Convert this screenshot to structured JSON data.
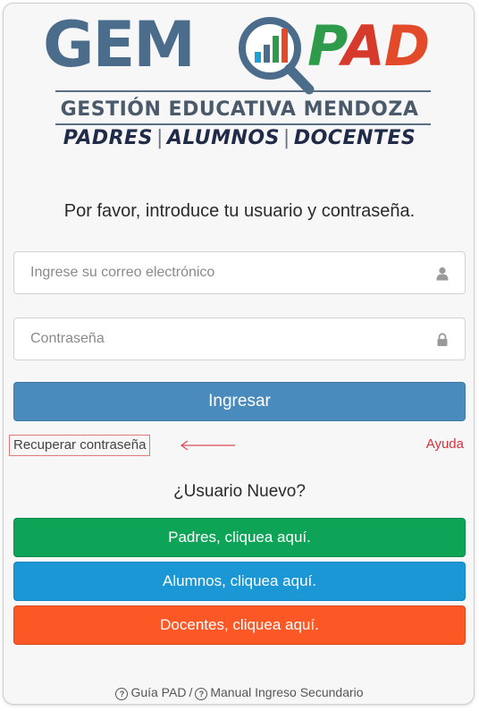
{
  "logo": {
    "gem": "GEM",
    "pad_p": "P",
    "pad_a": "A",
    "pad_d": "D",
    "subtitle": "GESTIÓN EDUCATIVA MENDOZA",
    "roles": [
      "PADRES",
      "ALUMNOS",
      "DOCENTES"
    ],
    "colors": {
      "gem": "#4b6c8a",
      "pad_p": "#2e9b4a",
      "pad_a": "#d63a2b",
      "pad_d": "#e24a2a"
    }
  },
  "login": {
    "prompt": "Por favor, introduce tu usuario y contraseña.",
    "email_placeholder": "Ingrese su correo electrónico",
    "email_value": "",
    "email_icon": "user-icon",
    "password_placeholder": "Contraseña",
    "password_value": "",
    "password_icon": "lock-icon",
    "submit_label": "Ingresar",
    "recover_label": "Recuperar contraseña",
    "help_label": "Ayuda"
  },
  "signup": {
    "heading": "¿Usuario Nuevo?",
    "padres_label": "Padres, cliquea aquí.",
    "alumnos_label": "Alumnos, cliquea aquí.",
    "docentes_label": "Docentes, cliquea aquí."
  },
  "footer": {
    "guide_label": "Guía PAD",
    "separator": "/",
    "manual_label": "Manual Ingreso Secundario"
  },
  "colors": {
    "login_button": "#4a8bbd",
    "padres_button": "#0ea458",
    "alumnos_button": "#1a97d4",
    "docentes_button": "#fb5826",
    "help_link": "#d9303a",
    "annotation": "#e07878"
  }
}
